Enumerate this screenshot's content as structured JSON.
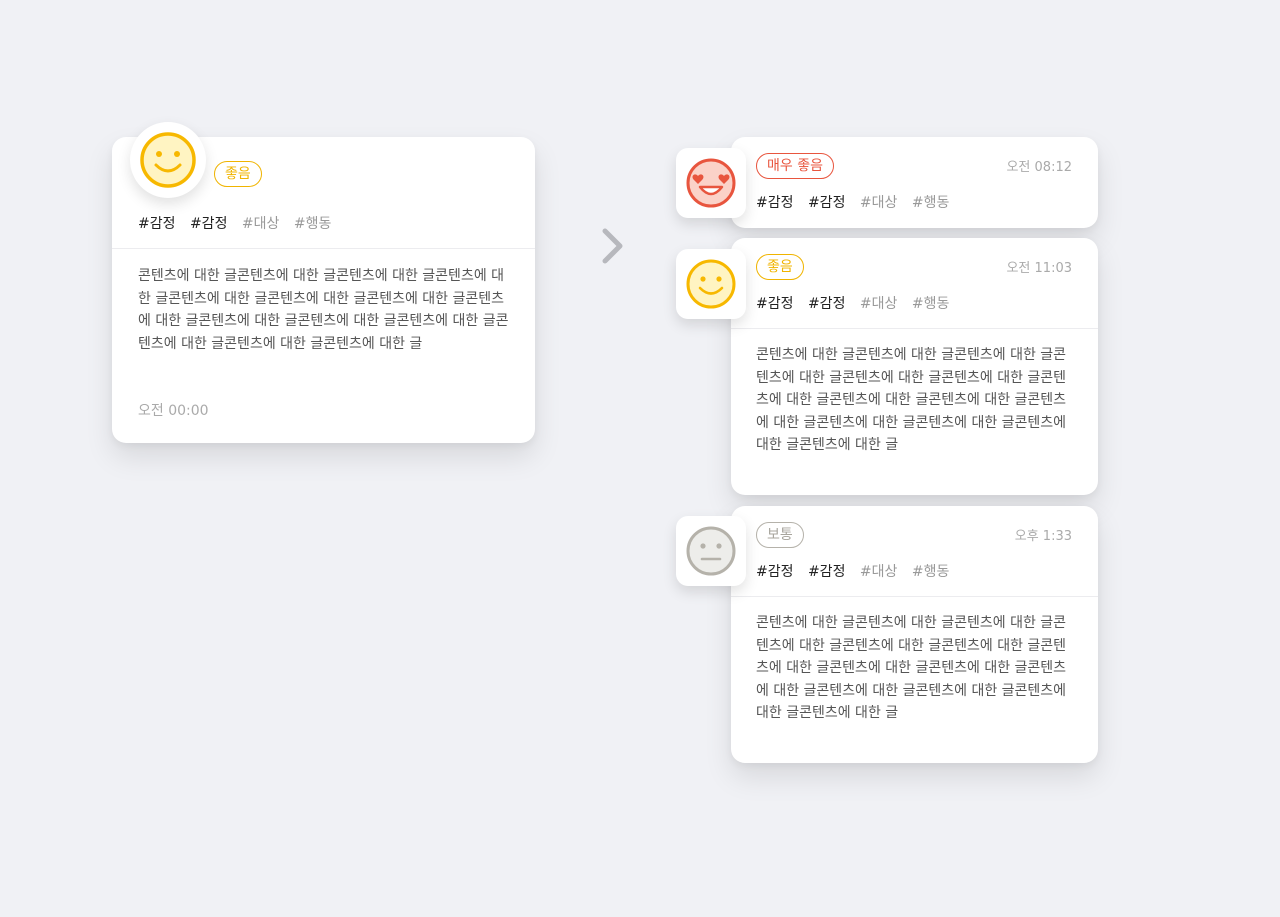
{
  "before": {
    "badge": "좋음",
    "badge_color": "#f0b400",
    "tags": [
      "#감정",
      "#감정",
      "#대상",
      "#행동"
    ],
    "content": "콘텐츠에 대한 글콘텐츠에 대한 글콘텐츠에 대한 글콘텐츠에 대한 글콘텐츠에 대한 글콘텐츠에 대한 글콘텐츠에 대한 글콘텐츠에 대한 글콘텐츠에 대한 글콘텐츠에 대한 글콘텐츠에 대한 글콘텐츠에 대한 글콘텐츠에 대한 글콘텐츠에 대한 글",
    "time": "오전 00:00",
    "icon": "smile-face-icon"
  },
  "arrow_icon": "chevron-right-icon",
  "after": [
    {
      "badge": "매우 좋음",
      "badge_color": "#e8553e",
      "time": "오전 08:12",
      "tags": [
        "#감정",
        "#감정",
        "#대상",
        "#행동"
      ],
      "icon": "heart-eyes-face-icon"
    },
    {
      "badge": "좋음",
      "badge_color": "#f0b400",
      "time": "오전 11:03",
      "tags": [
        "#감정",
        "#감정",
        "#대상",
        "#행동"
      ],
      "content": "콘텐츠에 대한 글콘텐츠에 대한 글콘텐츠에 대한 글콘텐츠에 대한 글콘텐츠에 대한 글콘텐츠에 대한 글콘텐츠에 대한 글콘텐츠에 대한 글콘텐츠에 대한 글콘텐츠에 대한 글콘텐츠에 대한 글콘텐츠에 대한 글콘텐츠에 대한 글콘텐츠에 대한 글",
      "icon": "smile-face-icon"
    },
    {
      "badge": "보통",
      "badge_color": "#b5b2aa",
      "time": "오후 1:33",
      "tags": [
        "#감정",
        "#감정",
        "#대상",
        "#행동"
      ],
      "content": "콘텐츠에 대한 글콘텐츠에 대한 글콘텐츠에 대한 글콘텐츠에 대한 글콘텐츠에 대한 글콘텐츠에 대한 글콘텐츠에 대한 글콘텐츠에 대한 글콘텐츠에 대한 글콘텐츠에 대한 글콘텐츠에 대한 글콘텐츠에 대한 글콘텐츠에 대한 글콘텐츠에 대한 글",
      "icon": "neutral-face-icon"
    }
  ]
}
